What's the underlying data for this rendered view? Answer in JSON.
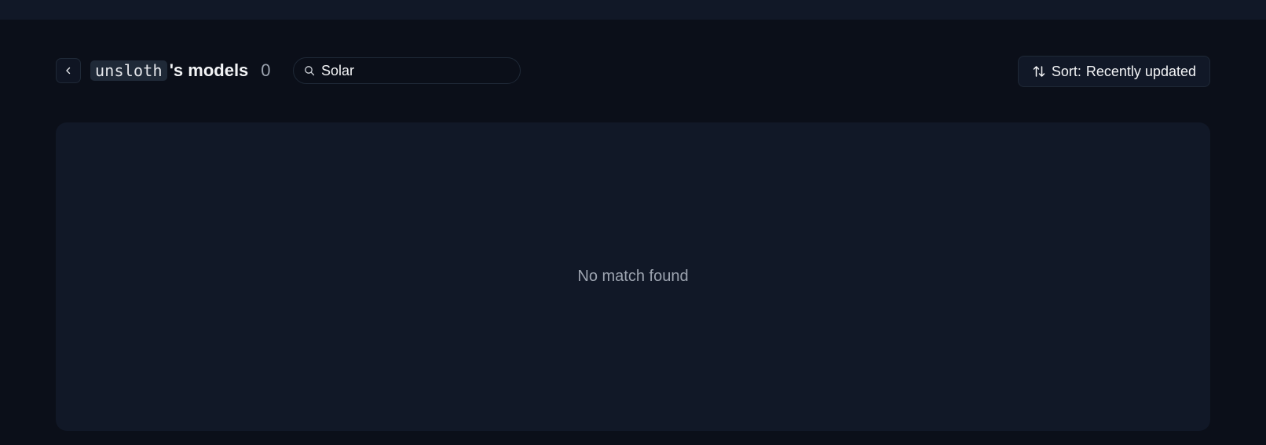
{
  "header": {
    "owner": "unsloth",
    "title_suffix": "'s models",
    "count": "0"
  },
  "search": {
    "value": "Solar",
    "icon": "search-icon"
  },
  "sort": {
    "label": "Sort:",
    "value": "Recently updated",
    "icon": "sort-arrows-icon"
  },
  "results": {
    "empty_message": "No match found"
  },
  "colors": {
    "background": "#0b0f19",
    "panel": "#111827",
    "muted_text": "#9ca3af"
  }
}
